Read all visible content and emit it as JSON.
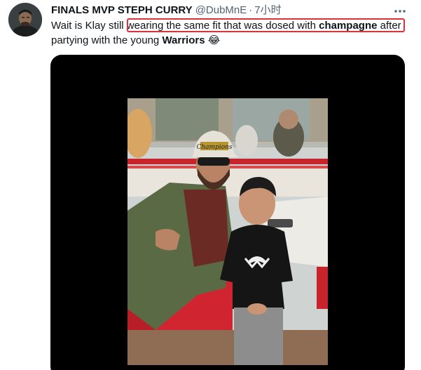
{
  "tweet": {
    "display_name": "FINALS MVP STEPH CURRY",
    "handle": "@DubMnE",
    "separator": "·",
    "time": "7小时",
    "text": {
      "part1": "Wait is Klay still ",
      "part2": "wearing the same fit that was dosed with ",
      "bold1": "champagne",
      "part3": " after partying with the young ",
      "bold2": "Warriors",
      "emoji": " 😂"
    }
  },
  "icons": {
    "avatar": "profile-avatar",
    "more": "more-options-icon"
  },
  "media": {
    "cap_text": "Champions",
    "colors": {
      "highlight_border": "#e0303c",
      "name": "#0f1419",
      "secondary": "#536471"
    }
  }
}
